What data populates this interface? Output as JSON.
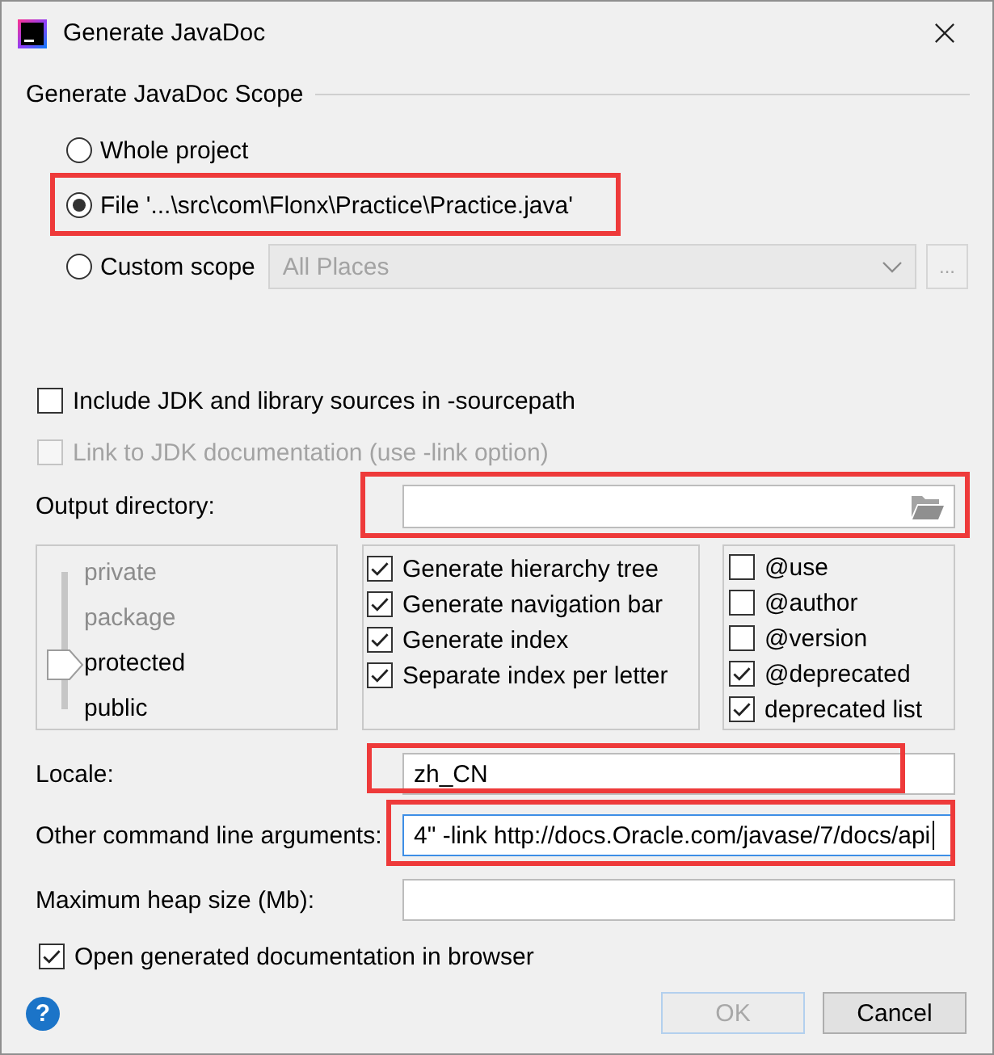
{
  "window": {
    "title": "Generate JavaDoc"
  },
  "scope": {
    "title": "Generate JavaDoc Scope",
    "options": [
      {
        "label": "Whole project",
        "selected": false,
        "highlighted": false
      },
      {
        "label": "File '...\\src\\com\\Flonx\\Practice\\Practice.java'",
        "selected": true,
        "highlighted": true
      },
      {
        "label": "Custom scope",
        "selected": false,
        "highlighted": false,
        "scope_picker": {
          "value": "All Places",
          "disabled": true
        },
        "browse_button": {
          "label": "...",
          "disabled": true
        }
      }
    ]
  },
  "source_options": [
    {
      "label": "Include JDK and library sources in -sourcepath",
      "checked": false,
      "disabled": false
    },
    {
      "label": "Link to JDK documentation (use -link option)",
      "checked": false,
      "disabled": true
    }
  ],
  "output_directory": {
    "label": "Output directory:",
    "highlighted": true
  },
  "visibility": [
    {
      "label": "private",
      "selected": false
    },
    {
      "label": "package",
      "selected": false
    },
    {
      "label": "protected",
      "selected": true
    },
    {
      "label": "public",
      "selected": false
    }
  ],
  "generate_options": [
    {
      "label": "Generate hierarchy tree",
      "checked": true
    },
    {
      "label": "Generate navigation bar",
      "checked": true
    },
    {
      "label": "Generate index",
      "checked": true
    },
    {
      "label": "Separate index per letter",
      "checked": true
    }
  ],
  "tags": [
    {
      "label": "@use",
      "checked": false
    },
    {
      "label": "@author",
      "checked": false
    },
    {
      "label": "@version",
      "checked": false
    },
    {
      "label": "@deprecated",
      "checked": true
    },
    {
      "label": "deprecated list",
      "checked": true
    }
  ],
  "fields": [
    {
      "label": "Locale:",
      "value": "zh_CN",
      "focused": false,
      "highlighted": true
    },
    {
      "label": "Other command line arguments:",
      "value": "4\" -link http://docs.Oracle.com/javase/7/docs/api",
      "focused": true,
      "highlighted": true
    },
    {
      "label": "Maximum heap size (Mb):",
      "focused": false,
      "highlighted": false
    }
  ],
  "open_in_browser": {
    "label": "Open generated documentation in browser",
    "checked": true
  },
  "help_button": {
    "label": "?"
  },
  "buttons": [
    {
      "label": "OK",
      "kind": "default",
      "disabled": true
    },
    {
      "label": "Cancel",
      "kind": "cancel",
      "disabled": false
    }
  ]
}
